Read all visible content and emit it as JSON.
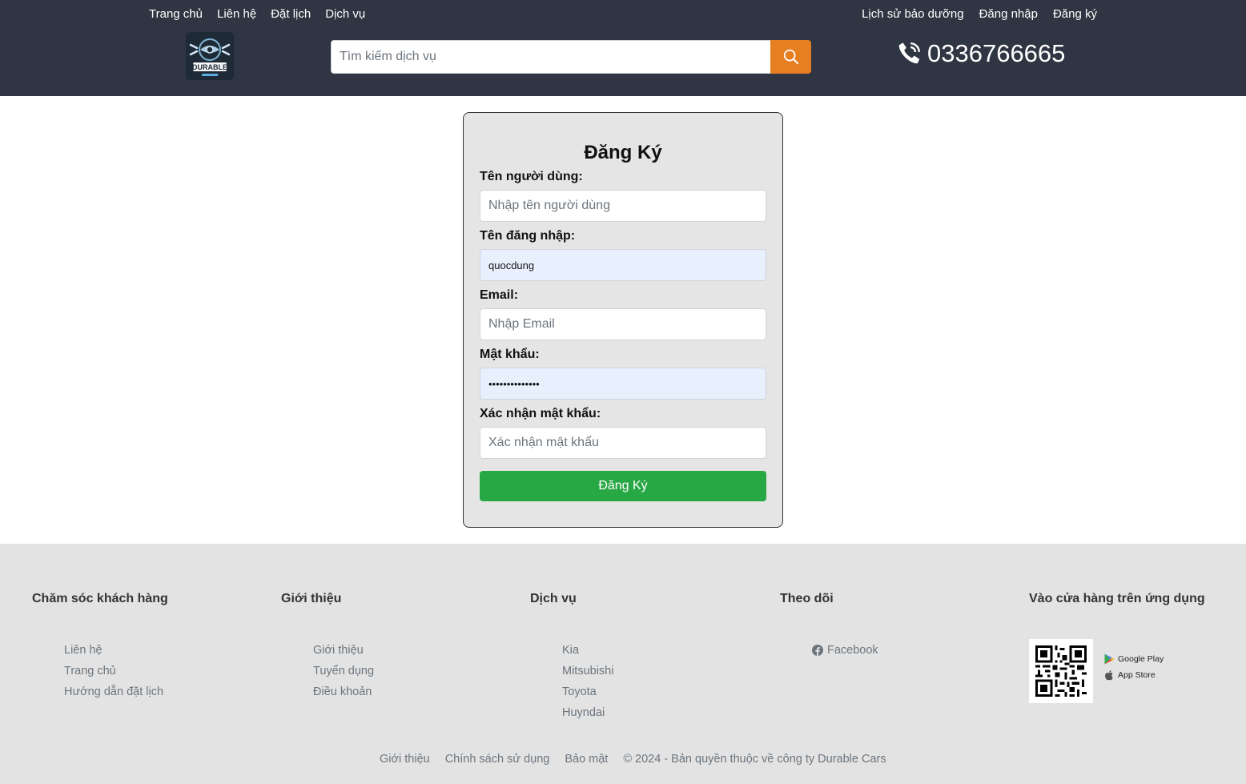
{
  "nav": {
    "left": [
      "Trang chủ",
      "Liên hệ",
      "Đặt lịch",
      "Dịch vụ"
    ],
    "right": [
      "Lịch sử bảo dưỡng",
      "Đăng nhập",
      "Đăng ký"
    ]
  },
  "logo": {
    "text": "DURABLE"
  },
  "search": {
    "placeholder": "Tìm kiếm dịch vụ",
    "icon": "search-icon",
    "button_color": "#e67e22"
  },
  "phone": {
    "icon": "phone-icon",
    "number": "0336766665"
  },
  "form": {
    "title": "Đăng Ký",
    "fields": [
      {
        "label": "Tên người dùng:",
        "placeholder": "Nhập tên người dùng",
        "value": ""
      },
      {
        "label": "Tên đăng nhập:",
        "placeholder": "",
        "value": "quocdung"
      },
      {
        "label": "Email:",
        "placeholder": "Nhập Email",
        "value": ""
      },
      {
        "label": "Mật khẩu:",
        "placeholder": "",
        "value": "••••••••••••••"
      },
      {
        "label": "Xác nhận mật khẩu:",
        "placeholder": "Xác nhận mật khẩu",
        "value": ""
      }
    ],
    "submit_label": "Đăng Ký",
    "submit_color": "#28a745"
  },
  "footer": {
    "columns": [
      {
        "title": "Chăm sóc khách hàng",
        "links": [
          "Liên hệ",
          "Trang chủ",
          "Hướng dẫn đặt lịch"
        ]
      },
      {
        "title": "Giới thiệu",
        "links": [
          "Giới thiệu",
          "Tuyển dụng",
          "Điều khoản"
        ]
      },
      {
        "title": "Dịch vụ",
        "links": [
          "Kia",
          "Mitsubishi",
          "Toyota",
          "Huyndai"
        ]
      },
      {
        "title": "Theo dõi",
        "links": [
          "Facebook"
        ]
      },
      {
        "title": "Vào cửa hàng trên ứng dụng",
        "links": []
      }
    ],
    "stores": [
      "Google Play",
      "App Store"
    ],
    "bottom_links": [
      "Giới thiệu",
      "Chính sách sử dụng",
      "Bảo mật"
    ],
    "copyright": "© 2024 - Bản quyền thuộc về công ty Durable Cars"
  }
}
